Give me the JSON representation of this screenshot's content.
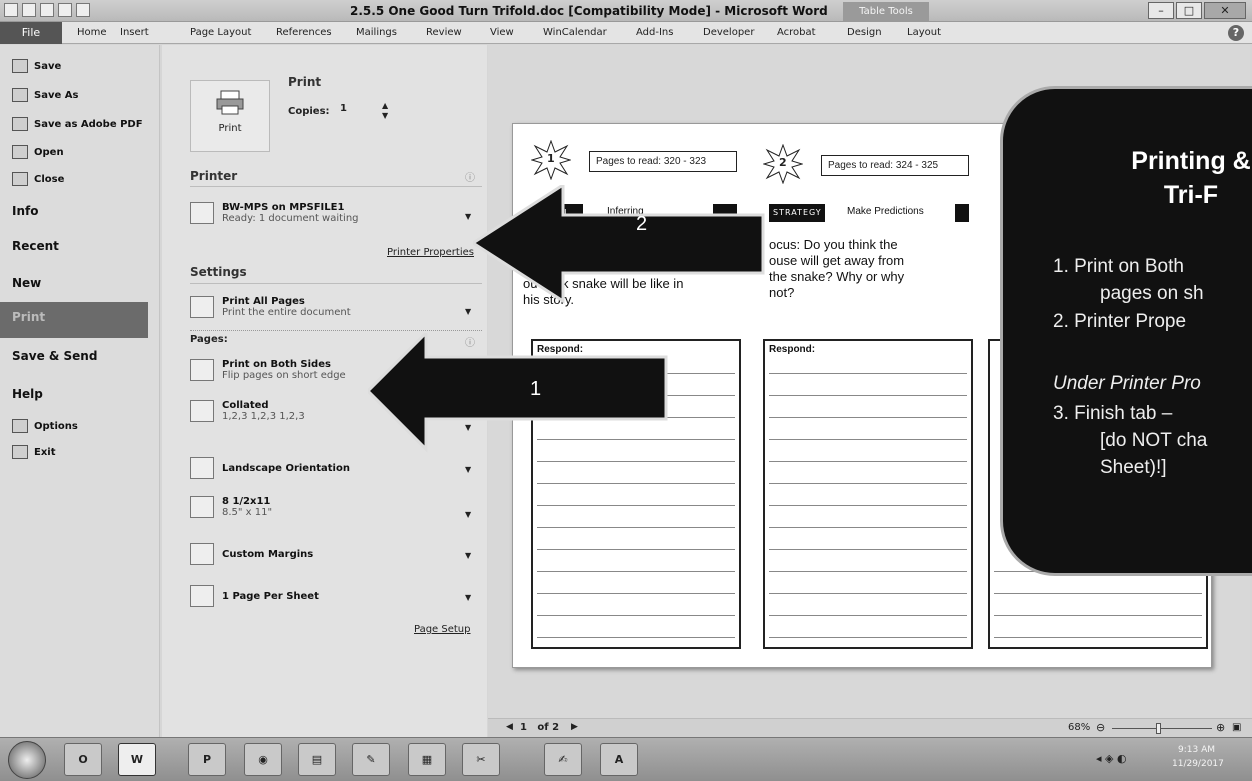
{
  "titlebar": {
    "title": "2.5.5 One Good Turn Trifold.doc [Compatibility Mode] - Microsoft Word",
    "context_tab": "Table Tools",
    "minimize": "–",
    "maximize": "□",
    "close": "✕"
  },
  "ribbon": {
    "file": "File",
    "tabs": [
      "Home",
      "Insert",
      "Page Layout",
      "References",
      "Mailings",
      "Review",
      "View",
      "WinCalendar",
      "Add-Ins",
      "Developer",
      "Acrobat",
      "Design",
      "Layout"
    ],
    "help": "?"
  },
  "leftnav": {
    "save": "Save",
    "save_as": "Save As",
    "save_as_pdf": "Save as Adobe PDF",
    "open": "Open",
    "close": "Close",
    "info": "Info",
    "recent": "Recent",
    "new": "New",
    "print": "Print",
    "save_send": "Save & Send",
    "help": "Help",
    "options": "Options",
    "exit": "Exit"
  },
  "print_panel": {
    "heading": "Print",
    "print_button": "Print",
    "copies_label": "Copies:",
    "copies_value": "1",
    "printer_heading": "Printer",
    "printer_name": "BW-MPS on MPSFILE1",
    "printer_status": "Ready: 1 document waiting",
    "printer_properties": "Printer Properties",
    "settings_heading": "Settings",
    "pages_label": "Pages:",
    "info_glyph": "ⓘ",
    "settings": [
      {
        "title": "Print All Pages",
        "sub": "Print the entire document"
      },
      {
        "title": "Print on Both Sides",
        "sub": "Flip pages on short edge"
      },
      {
        "title": "Collated",
        "sub": "1,2,3   1,2,3   1,2,3"
      },
      {
        "title": "Landscape Orientation",
        "sub": ""
      },
      {
        "title": "8 1/2x11",
        "sub": "8.5\" x 11\""
      },
      {
        "title": "Custom Margins",
        "sub": ""
      },
      {
        "title": "1 Page Per Sheet",
        "sub": ""
      }
    ],
    "page_setup": "Page Setup"
  },
  "preview": {
    "col1": {
      "num": "1",
      "pages": "Pages to read: 320 - 323",
      "tag": "SKILL",
      "skill": "Inferring",
      "question": "ou think snake will be like in\nhis story.",
      "respond": "Respond:"
    },
    "col2": {
      "num": "2",
      "pages": "Pages to read: 324 - 325",
      "tag": "STRATEGY",
      "skill": "Make Predictions",
      "question": "ocus: Do you think the\nouse will get away from\nthe snake?  Why or why\nnot?",
      "respond": "Respond:"
    },
    "page_nav": "1   of 2",
    "zoom": "68%"
  },
  "arrows": {
    "arrow1": "1",
    "arrow2": "2"
  },
  "overlay": {
    "title": "Printing & Tri-F",
    "step1": "1.  Print on Both",
    "step1b": "pages on sh",
    "step2": "2.  Printer Prope",
    "under": "Under Printer Pro",
    "step3": "3.  Finish tab – ",
    "step3b": "[do NOT cha",
    "step3c": "Sheet)!]"
  },
  "taskbar": {
    "clock_time": "9:13 AM",
    "clock_date": "11/29/2017",
    "apps": [
      "Outlook",
      "Word",
      "Publisher",
      "Chrome",
      "Files",
      "Paint",
      "Calc",
      "Snip",
      "Notes",
      "Acrobat"
    ]
  }
}
